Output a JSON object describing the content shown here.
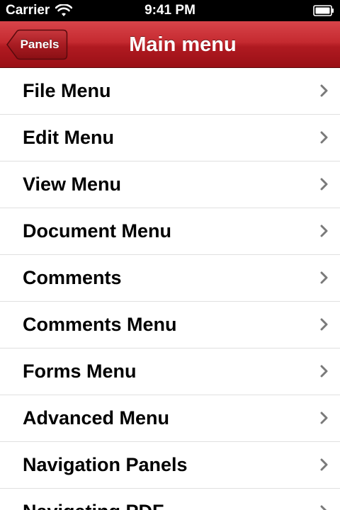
{
  "status_bar": {
    "carrier": "Carrier",
    "time": "9:41 PM",
    "wifi_icon": "wifi-icon",
    "battery_icon": "battery-icon"
  },
  "nav_bar": {
    "back_label": "Panels",
    "title": "Main menu",
    "accent_color": "#c52a30"
  },
  "menu": {
    "items": [
      {
        "label": "File Menu"
      },
      {
        "label": "Edit Menu"
      },
      {
        "label": "View Menu"
      },
      {
        "label": "Document Menu"
      },
      {
        "label": "Comments"
      },
      {
        "label": "Comments Menu"
      },
      {
        "label": "Forms Menu"
      },
      {
        "label": "Advanced Menu"
      },
      {
        "label": "Navigation Panels"
      },
      {
        "label": "Navigating PDF"
      }
    ],
    "chevron_icon": "chevron-right-icon"
  }
}
